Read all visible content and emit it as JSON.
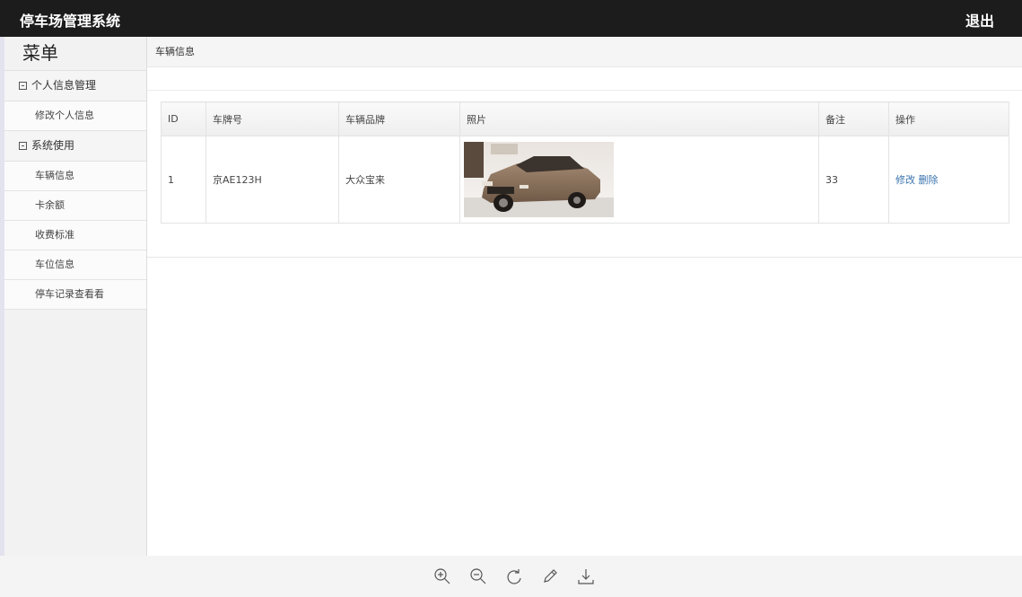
{
  "header": {
    "title": "停车场管理系统",
    "logout_label": "退出"
  },
  "sidebar": {
    "title": "菜单",
    "groups": [
      {
        "label": "个人信息管理",
        "items": [
          "修改个人信息"
        ]
      },
      {
        "label": "系统使用",
        "items": [
          "车辆信息",
          "卡余额",
          "收费标准",
          "车位信息",
          "停车记录查看看"
        ]
      }
    ]
  },
  "breadcrumb": "车辆信息",
  "table": {
    "columns": [
      "ID",
      "车牌号",
      "车辆品牌",
      "照片",
      "备注",
      "操作"
    ],
    "rows": [
      {
        "id": "1",
        "plate": "京AE123H",
        "brand": "大众宝来",
        "photo_icon": "car-photo",
        "remark": "33",
        "edit_label": "修改",
        "delete_label": "删除"
      }
    ]
  },
  "toolbar": {
    "icons": [
      "zoom-in-icon",
      "zoom-out-icon",
      "rotate-icon",
      "edit-icon",
      "download-icon"
    ]
  },
  "colors": {
    "header_bg": "#1c1c1c",
    "sidebar_bg": "#f2f2f2",
    "link": "#3a73ad"
  }
}
